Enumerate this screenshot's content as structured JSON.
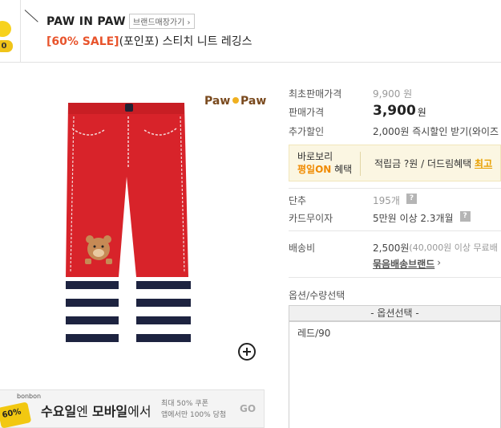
{
  "header": {
    "brand_name": "PAW IN PAW",
    "brand_shop_button": "브랜드매장가기 ›",
    "coin_badge": "0",
    "title_sale": "[60% SALE]",
    "title_rest": "(포인포) 스티치 니트 레깅스"
  },
  "product": {
    "logo_text": "Paw Paw",
    "zoom_icon": "zoom-in-icon"
  },
  "info": {
    "original_price_label": "최초판매가격",
    "original_price_value": "9,900 원",
    "sale_price_label": "판매가격",
    "sale_price_value": "3,900",
    "sale_price_unit": "원",
    "extra_discount_label": "추가할인",
    "extra_discount_value": "2,000원 즉시할인 받기(와이즈",
    "benefit_line1": "바로보리",
    "benefit_line2_on": "평일ON",
    "benefit_line2_rest": " 혜택",
    "benefit_right_text": "적립금 ?원 / 더드림혜택 ",
    "benefit_right_best": "최고",
    "points_label": "단추",
    "points_value": "195개",
    "card_label": "카드무이자",
    "card_value": "5만원 이상 2.3개월",
    "shipping_label": "배송비",
    "shipping_value": "2,500원",
    "shipping_note": " (40,000원 이상 무료배",
    "bundle_link": "묶음배송브랜드",
    "option_label": "옵션/수량선택",
    "option_select": "- 옵션선택 -",
    "option_items": [
      "레드/90"
    ]
  },
  "banner": {
    "coin_text": "60%",
    "coin_brand": "bonbon",
    "main_pre": "수요일",
    "main_mid": "엔 ",
    "main_bold": "모바일",
    "main_post": "에서",
    "sub_line1": "최대 50% 쿠폰",
    "sub_line2": "앱에서만 100% 당첨",
    "go": "GO"
  },
  "colors": {
    "sale": "#e8542c",
    "accent": "#f08a00",
    "pants_red": "#d8232a",
    "stripe_navy": "#1d2340"
  }
}
